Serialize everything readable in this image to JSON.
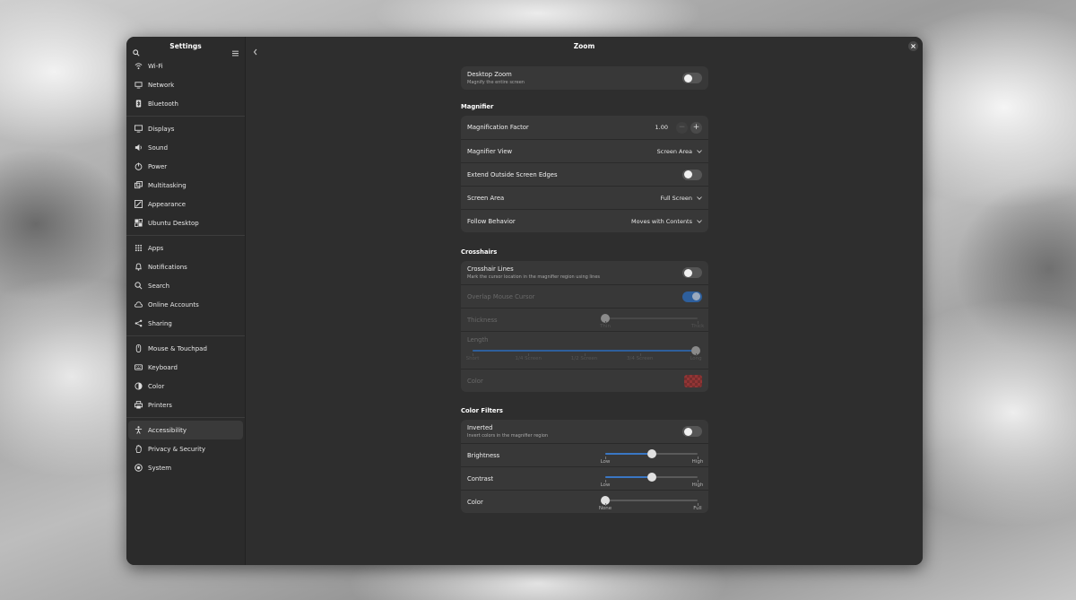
{
  "sidebar": {
    "title": "Settings",
    "groups": [
      [
        {
          "label": "Wi-Fi",
          "icon": "wifi-icon"
        },
        {
          "label": "Network",
          "icon": "network-icon"
        },
        {
          "label": "Bluetooth",
          "icon": "bluetooth-icon"
        }
      ],
      [
        {
          "label": "Displays",
          "icon": "display-icon"
        },
        {
          "label": "Sound",
          "icon": "sound-icon"
        },
        {
          "label": "Power",
          "icon": "power-icon"
        },
        {
          "label": "Multitasking",
          "icon": "multitasking-icon"
        },
        {
          "label": "Appearance",
          "icon": "appearance-icon"
        },
        {
          "label": "Ubuntu Desktop",
          "icon": "ubuntu-desktop-icon"
        }
      ],
      [
        {
          "label": "Apps",
          "icon": "apps-icon"
        },
        {
          "label": "Notifications",
          "icon": "bell-icon"
        },
        {
          "label": "Search",
          "icon": "search-icon"
        },
        {
          "label": "Online Accounts",
          "icon": "cloud-icon"
        },
        {
          "label": "Sharing",
          "icon": "share-icon"
        }
      ],
      [
        {
          "label": "Mouse & Touchpad",
          "icon": "mouse-icon"
        },
        {
          "label": "Keyboard",
          "icon": "keyboard-icon"
        },
        {
          "label": "Color",
          "icon": "color-icon"
        },
        {
          "label": "Printers",
          "icon": "printer-icon"
        }
      ],
      [
        {
          "label": "Accessibility",
          "icon": "accessibility-icon",
          "active": true
        },
        {
          "label": "Privacy & Security",
          "icon": "hand-icon"
        },
        {
          "label": "System",
          "icon": "system-icon"
        }
      ]
    ]
  },
  "main": {
    "title": "Zoom",
    "desktop_zoom": {
      "label": "Desktop Zoom",
      "sub": "Magnify the entire screen",
      "on": false
    },
    "magnifier": {
      "title": "Magnifier",
      "factor_label": "Magnification Factor",
      "factor_value": "1.00",
      "minus": "−",
      "plus": "+",
      "view_label": "Magnifier View",
      "view_value": "Screen Area",
      "extend_label": "Extend Outside Screen Edges",
      "extend_on": false,
      "area_label": "Screen Area",
      "area_value": "Full Screen",
      "follow_label": "Follow Behavior",
      "follow_value": "Moves with Contents"
    },
    "crosshairs": {
      "title": "Crosshairs",
      "lines_label": "Crosshair Lines",
      "lines_sub": "Mark the cursor location in the magnifier region using lines",
      "lines_on": false,
      "overlap_label": "Overlap Mouse Cursor",
      "overlap_on": true,
      "thickness_label": "Thickness",
      "thickness_min": "Thin",
      "thickness_max": "Thick",
      "thickness_value": 0.0,
      "length_label": "Length",
      "length_ticks": [
        "Short",
        "1/4 Screen",
        "1/2 Screen",
        "3/4 Screen",
        "Long"
      ],
      "length_value": 1.0,
      "color_label": "Color"
    },
    "filters": {
      "title": "Color Filters",
      "inverted_label": "Inverted",
      "inverted_sub": "Invert colors in the magnifier region",
      "inverted_on": false,
      "brightness_label": "Brightness",
      "brightness_min": "Low",
      "brightness_max": "High",
      "brightness_value": 0.5,
      "contrast_label": "Contrast",
      "contrast_min": "Low",
      "contrast_max": "High",
      "contrast_value": 0.5,
      "color_label": "Color",
      "color_min": "None",
      "color_max": "Full",
      "color_value": 0.0
    }
  },
  "colors": {
    "accent": "#3a77c4",
    "window_bg": "#2e2e2e",
    "card_bg": "#383838"
  }
}
